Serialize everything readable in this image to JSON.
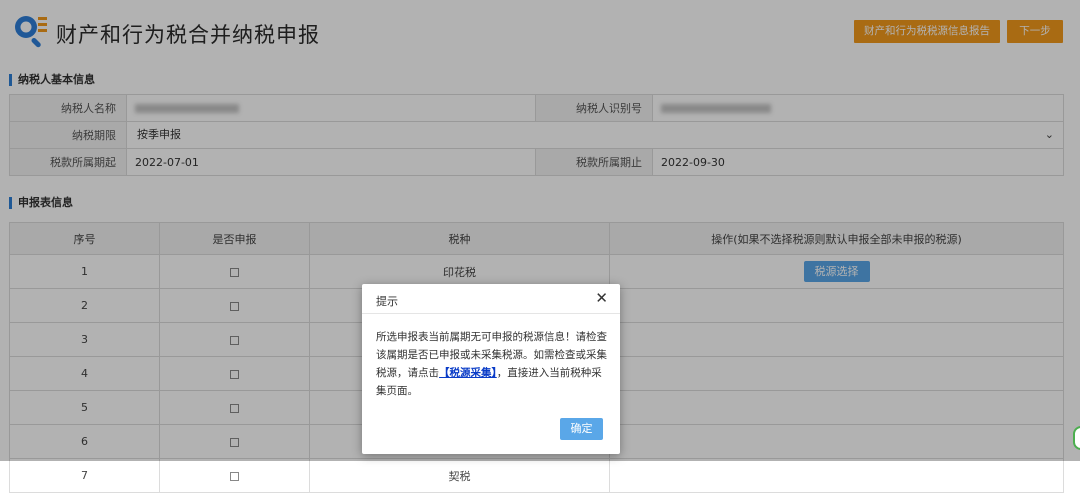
{
  "header": {
    "title": "财产和行为税合并纳税申报",
    "report_button": "财产和行为税税源信息报告",
    "next_button": "下一步"
  },
  "basic_info": {
    "section_title": "纳税人基本信息",
    "name_label": "纳税人名称",
    "id_label": "纳税人识别号",
    "period_label": "纳税期限",
    "period_value": "按季申报",
    "start_label": "税款所属期起",
    "start_value": "2022-07-01",
    "end_label": "税款所属期止",
    "end_value": "2022-09-30"
  },
  "declaration": {
    "section_title": "申报表信息",
    "columns": [
      "序号",
      "是否申报",
      "税种",
      "操作(如果不选择税源则默认申报全部未申报的税源)"
    ],
    "rows": [
      {
        "no": "1",
        "tax": "印花税",
        "action": "税源选择"
      },
      {
        "no": "2",
        "tax": "",
        "action": ""
      },
      {
        "no": "3",
        "tax": "",
        "action": ""
      },
      {
        "no": "4",
        "tax": "",
        "action": ""
      },
      {
        "no": "5",
        "tax": "",
        "action": ""
      },
      {
        "no": "6",
        "tax": "",
        "action": ""
      },
      {
        "no": "7",
        "tax": "契税",
        "action": ""
      }
    ]
  },
  "dialog": {
    "title": "提示",
    "body_before": "所选申报表当前属期无可申报的税源信息！请检查该属期是否已申报或未采集税源。如需检查或采集税源，请点击",
    "link": "【税源采集】",
    "body_after": "，直接进入当前税种采集页面。",
    "ok_button": "确定"
  },
  "colors": {
    "accent_orange": "#f39a1c",
    "button_blue": "#5aa7e8",
    "link_blue": "#0a3cc7",
    "section_bar": "#2d7fd6"
  },
  "icons": {
    "logo": "search-magnifier-icon",
    "close": "close-icon",
    "select": "chevron-down-icon"
  }
}
